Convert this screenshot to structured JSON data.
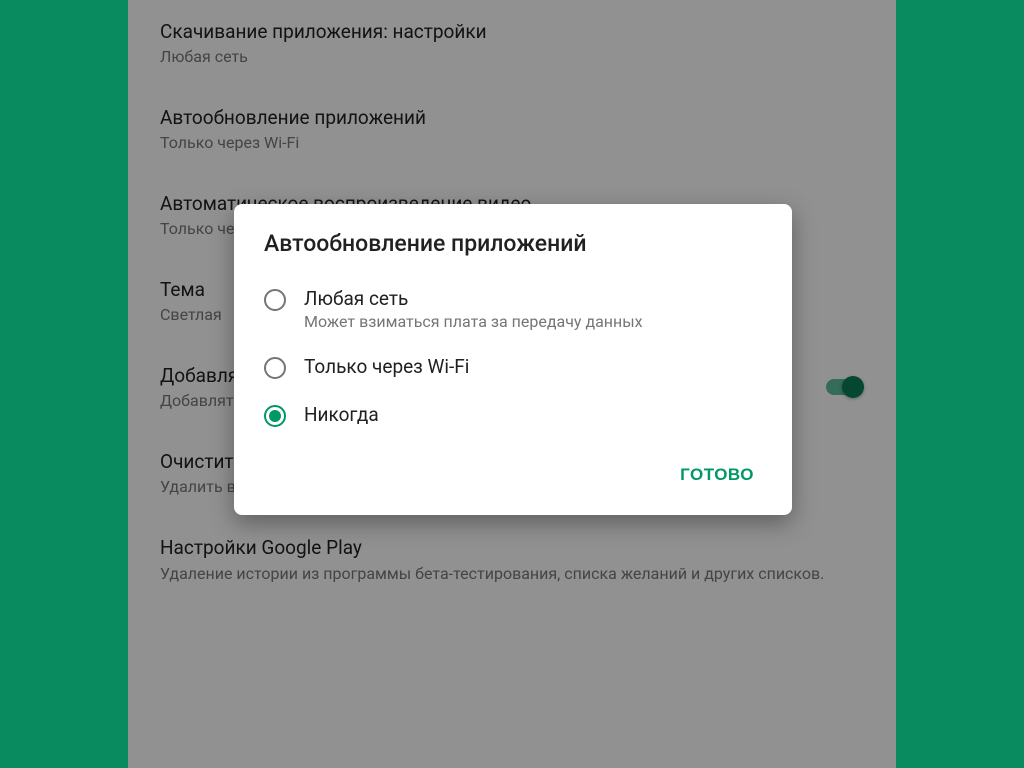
{
  "settings": {
    "items": [
      {
        "title": "Скачивание приложения: настройки",
        "subtitle": "Любая сеть"
      },
      {
        "title": "Автообновление приложений",
        "subtitle": "Только через Wi-Fi"
      },
      {
        "title": "Автоматическое воспроизведение видео",
        "subtitle": "Только через Wi-Fi"
      },
      {
        "title": "Тема",
        "subtitle": "Светлая"
      },
      {
        "title": "Добавлять значки",
        "subtitle": "Добавлять значки установленных приложений на главный экран"
      },
      {
        "title": "Очистить историю поиска",
        "subtitle": "Удалить все поисковые запросы с этого устройства"
      },
      {
        "title": "Настройки Google Play",
        "subtitle": "Удаление истории из программы бета-тестирования, списка желаний и других списков."
      }
    ]
  },
  "dialog": {
    "title": "Автообновление приложений",
    "options": [
      {
        "label": "Любая сеть",
        "sublabel": "Может взиматься плата за передачу данных",
        "selected": false
      },
      {
        "label": "Только через Wi-Fi",
        "sublabel": "",
        "selected": false
      },
      {
        "label": "Никогда",
        "sublabel": "",
        "selected": true
      }
    ],
    "confirm": "ГОТОВО"
  },
  "colors": {
    "accent": "#009966"
  }
}
